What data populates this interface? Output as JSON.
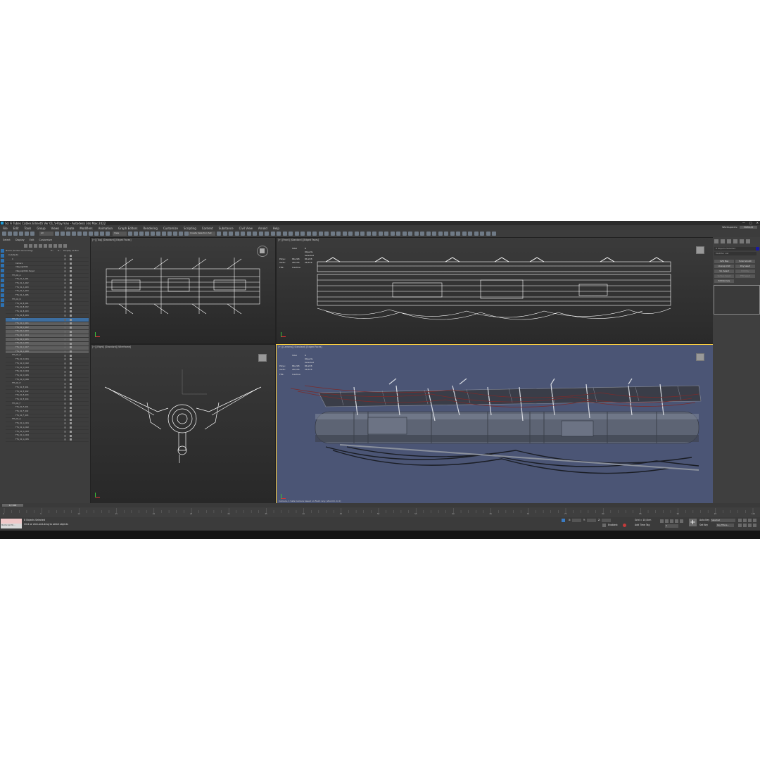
{
  "app": {
    "title": "Sci Fi Tubes Cables Ellinetti Ver 01_V-Ray.max - Autodesk 3ds Max 2022",
    "window_buttons": [
      "—",
      "□",
      "✕"
    ]
  },
  "menu": [
    "File",
    "Edit",
    "Tools",
    "Group",
    "Views",
    "Create",
    "Modifiers",
    "Animation",
    "Graph Editors",
    "Rendering",
    "Customize",
    "Scripting",
    "Content",
    "Substance",
    "Civil View",
    "Arnold",
    "Help"
  ],
  "workspace": {
    "label": "Workspaces:",
    "value": "Default"
  },
  "toolbar": {
    "filter": "All",
    "view": "View",
    "selection_set": "Create Selection Set"
  },
  "explorer": {
    "menu": [
      "Select",
      "Display",
      "Edit",
      "Customize"
    ],
    "columns": [
      "Name (Sorted Ascending)",
      "Fr...",
      "R...",
      "Display as Box"
    ],
    "rows": [
      {
        "name": "0 (default)",
        "indent": 0,
        "state": ""
      },
      {
        "name": "0",
        "indent": 1,
        "state": ""
      },
      {
        "name": "Camera",
        "indent": 2,
        "state": ""
      },
      {
        "name": "VRayLight001",
        "indent": 2,
        "state": ""
      },
      {
        "name": "VRayLight001.Target",
        "indent": 2,
        "state": ""
      },
      {
        "name": "TTS_01_A",
        "indent": 1,
        "state": ""
      },
      {
        "name": "TTS_01_A_001",
        "indent": 2,
        "state": ""
      },
      {
        "name": "TTS_01_A_002",
        "indent": 2,
        "state": ""
      },
      {
        "name": "TTS_01_A_003",
        "indent": 2,
        "state": ""
      },
      {
        "name": "TTS_01_A_004",
        "indent": 2,
        "state": ""
      },
      {
        "name": "TTS_01_A_005",
        "indent": 2,
        "state": ""
      },
      {
        "name": "TTS_01_B",
        "indent": 1,
        "state": ""
      },
      {
        "name": "TTS_01_B_001",
        "indent": 2,
        "state": ""
      },
      {
        "name": "TTS_01_B_002",
        "indent": 2,
        "state": ""
      },
      {
        "name": "TTS_01_B_003",
        "indent": 2,
        "state": ""
      },
      {
        "name": "TTS_01_B_004",
        "indent": 2,
        "state": ""
      },
      {
        "name": "TTS_01_C",
        "indent": 1,
        "state": "hl"
      },
      {
        "name": "TTS_01_C_001",
        "indent": 2,
        "state": "sel"
      },
      {
        "name": "TTS_01_C_002",
        "indent": 2,
        "state": "sel"
      },
      {
        "name": "TTS_01_C_003",
        "indent": 2,
        "state": "sel"
      },
      {
        "name": "TTS_01_C_004",
        "indent": 2,
        "state": "sel"
      },
      {
        "name": "TTS_01_C_005",
        "indent": 2,
        "state": "sel"
      },
      {
        "name": "TTS_01_C_006",
        "indent": 2,
        "state": "sel"
      },
      {
        "name": "TTS_01_C_007",
        "indent": 2,
        "state": "sel"
      },
      {
        "name": "TTS_01_C_008",
        "indent": 2,
        "state": "sel"
      },
      {
        "name": "TTS_01_D",
        "indent": 1,
        "state": ""
      },
      {
        "name": "TTS_01_D_001",
        "indent": 2,
        "state": ""
      },
      {
        "name": "TTS_01_D_002",
        "indent": 2,
        "state": ""
      },
      {
        "name": "TTS_01_D_003",
        "indent": 2,
        "state": ""
      },
      {
        "name": "TTS_01_D_004",
        "indent": 2,
        "state": ""
      },
      {
        "name": "TTS_01_D_005",
        "indent": 2,
        "state": ""
      },
      {
        "name": "TTS_01_D_006",
        "indent": 2,
        "state": ""
      },
      {
        "name": "TTS_01_E",
        "indent": 1,
        "state": ""
      },
      {
        "name": "TTS_01_E_001",
        "indent": 2,
        "state": ""
      },
      {
        "name": "TTS_01_E_002",
        "indent": 2,
        "state": ""
      },
      {
        "name": "TTS_01_E_003",
        "indent": 2,
        "state": ""
      },
      {
        "name": "TTS_01_E_004",
        "indent": 2,
        "state": ""
      },
      {
        "name": "TTS_01_F",
        "indent": 1,
        "state": ""
      },
      {
        "name": "TTS_01_F_001",
        "indent": 2,
        "state": ""
      },
      {
        "name": "TTS_01_F_002",
        "indent": 2,
        "state": ""
      },
      {
        "name": "TTS_01_F_003",
        "indent": 2,
        "state": ""
      },
      {
        "name": "TTS_01_G",
        "indent": 1,
        "state": ""
      },
      {
        "name": "TTS_01_G_001",
        "indent": 2,
        "state": ""
      },
      {
        "name": "TTS_01_G_002",
        "indent": 2,
        "state": ""
      },
      {
        "name": "TTS_01_G_003",
        "indent": 2,
        "state": ""
      },
      {
        "name": "TTS_01_G_004",
        "indent": 2,
        "state": ""
      },
      {
        "name": "TTS_01_G_005",
        "indent": 2,
        "state": ""
      }
    ],
    "layer_explorer": "Layer Explorer",
    "selection_set": "Selection Set:"
  },
  "viewports": {
    "top": {
      "label": "[+] [Top] [Standard] [Edged Faces]"
    },
    "front": {
      "label": "[+] [Front] [Standard] [Edged Faces]"
    },
    "right": {
      "label": "[+] [Right] [Standard] [Wireframe]"
    },
    "persp": {
      "label": "[+] [Camera] [Standard] [Edged Faces]",
      "status": "Camera, 1 Safe Camera based on Field: Any: (Zoom3, 0, 0)"
    },
    "stats": {
      "hdr_total": "Total",
      "hdr_sel": "8 Objects Selected",
      "polys_label": "Polys:",
      "polys_total": "86,228",
      "polys_sel": "86,228",
      "verts_label": "Verts:",
      "verts_total": "28,576",
      "verts_sel": "28,576",
      "fps_label": "FPS:",
      "fps_value": "Inactive"
    }
  },
  "command_panel": {
    "field1": "8 Objects Selected",
    "field2": "Modifier List",
    "buttons": [
      "UVW Map",
      "Turbo Smooth",
      "Unwrap UVW",
      "Poly Select",
      "Vol. Select",
      "Edit Poly",
      "Surface Select",
      "FFD Select",
      "Edit Normals"
    ]
  },
  "timeline": {
    "slider": "0 / 100",
    "ticks": [
      "0",
      "5",
      "10",
      "15",
      "20",
      "25",
      "30",
      "35",
      "40",
      "45",
      "50",
      "55",
      "60",
      "65",
      "70",
      "75",
      "80",
      "85",
      "90",
      "95",
      "100"
    ]
  },
  "status": {
    "maxscript": "MAXScript Mi...",
    "line1": "8 Objects Selected",
    "line2": "Click or click-and-drag to select objects",
    "x_label": "X:",
    "y_label": "Y:",
    "z_label": "Z:",
    "grid": "Grid = 10,0cm",
    "enabled": "Enabled:",
    "add_time_tag": "Add Time Tag",
    "auto_key": "Auto Key",
    "set_key": "Set Key",
    "selected": "Selected",
    "key_filters": "Key Filters...",
    "frame": "0"
  },
  "colors": {
    "accent": "#3d6ea0",
    "viewport_bg": "#2f2f2f",
    "persp_bg": "#4a5472",
    "panel": "#444444"
  }
}
